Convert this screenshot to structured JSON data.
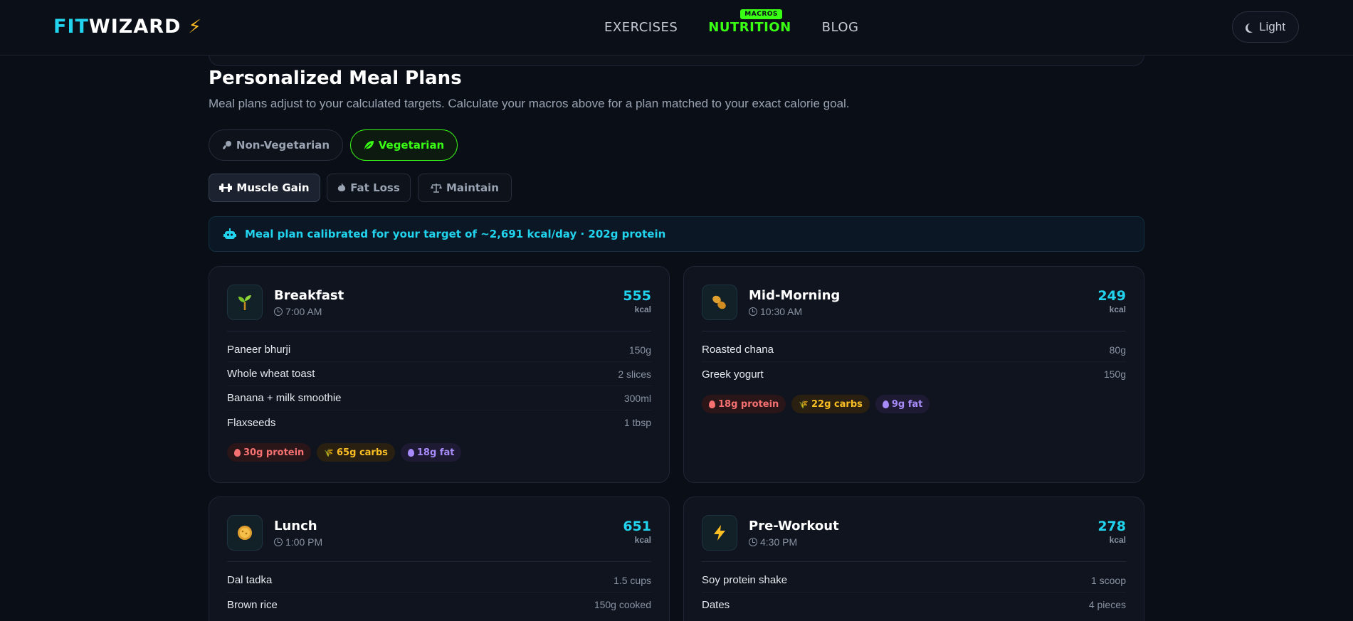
{
  "header": {
    "logo_part1": "FIT",
    "logo_part2": "WIZARD",
    "nav": [
      {
        "label": "EXERCISES"
      },
      {
        "label": "NUTRITION",
        "badge": "MACROS"
      },
      {
        "label": "BLOG"
      }
    ],
    "theme_label": "Light"
  },
  "section": {
    "title": "Personalized Meal Plans",
    "subtitle": "Meal plans adjust to your calculated targets. Calculate your macros above for a plan matched to your exact calorie goal.",
    "diet_tabs": [
      {
        "label": "Non-Vegetarian"
      },
      {
        "label": "Vegetarian"
      }
    ],
    "goal_tabs": [
      {
        "label": "Muscle Gain"
      },
      {
        "label": "Fat Loss"
      },
      {
        "label": "Maintain"
      }
    ],
    "notice": "Meal plan calibrated for your target of ~2,691 kcal/day · 202g protein"
  },
  "meals": [
    {
      "name": "Breakfast",
      "time": "7:00 AM",
      "kcal": "555",
      "unit": "kcal",
      "icon": "sprout-icon",
      "items": [
        {
          "food": "Paneer bhurji",
          "qty": "150g"
        },
        {
          "food": "Whole wheat toast",
          "qty": "2 slices"
        },
        {
          "food": "Banana + milk smoothie",
          "qty": "300ml"
        },
        {
          "food": "Flaxseeds",
          "qty": "1 tbsp"
        }
      ],
      "macros": {
        "protein": "30g protein",
        "carbs": "65g carbs",
        "fat": "18g fat"
      }
    },
    {
      "name": "Mid-Morning",
      "time": "10:30 AM",
      "kcal": "249",
      "unit": "kcal",
      "icon": "peanut-icon",
      "items": [
        {
          "food": "Roasted chana",
          "qty": "80g"
        },
        {
          "food": "Greek yogurt",
          "qty": "150g"
        }
      ],
      "macros": {
        "protein": "18g protein",
        "carbs": "22g carbs",
        "fat": "9g fat"
      }
    },
    {
      "name": "Lunch",
      "time": "1:00 PM",
      "kcal": "651",
      "unit": "kcal",
      "icon": "food-bowl-icon",
      "items": [
        {
          "food": "Dal tadka",
          "qty": "1.5 cups"
        },
        {
          "food": "Brown rice",
          "qty": "150g cooked"
        }
      ]
    },
    {
      "name": "Pre-Workout",
      "time": "4:30 PM",
      "kcal": "278",
      "unit": "kcal",
      "icon": "lightning-icon",
      "items": [
        {
          "food": "Soy protein shake",
          "qty": "1 scoop"
        },
        {
          "food": "Dates",
          "qty": "4 pieces"
        }
      ]
    }
  ],
  "colors": {
    "accent_cyan": "#22d3ee",
    "accent_green": "#39ff14",
    "protein": "#f87171",
    "carbs": "#fbbf24",
    "fat": "#a78bfa",
    "background": "#0a0e17"
  }
}
